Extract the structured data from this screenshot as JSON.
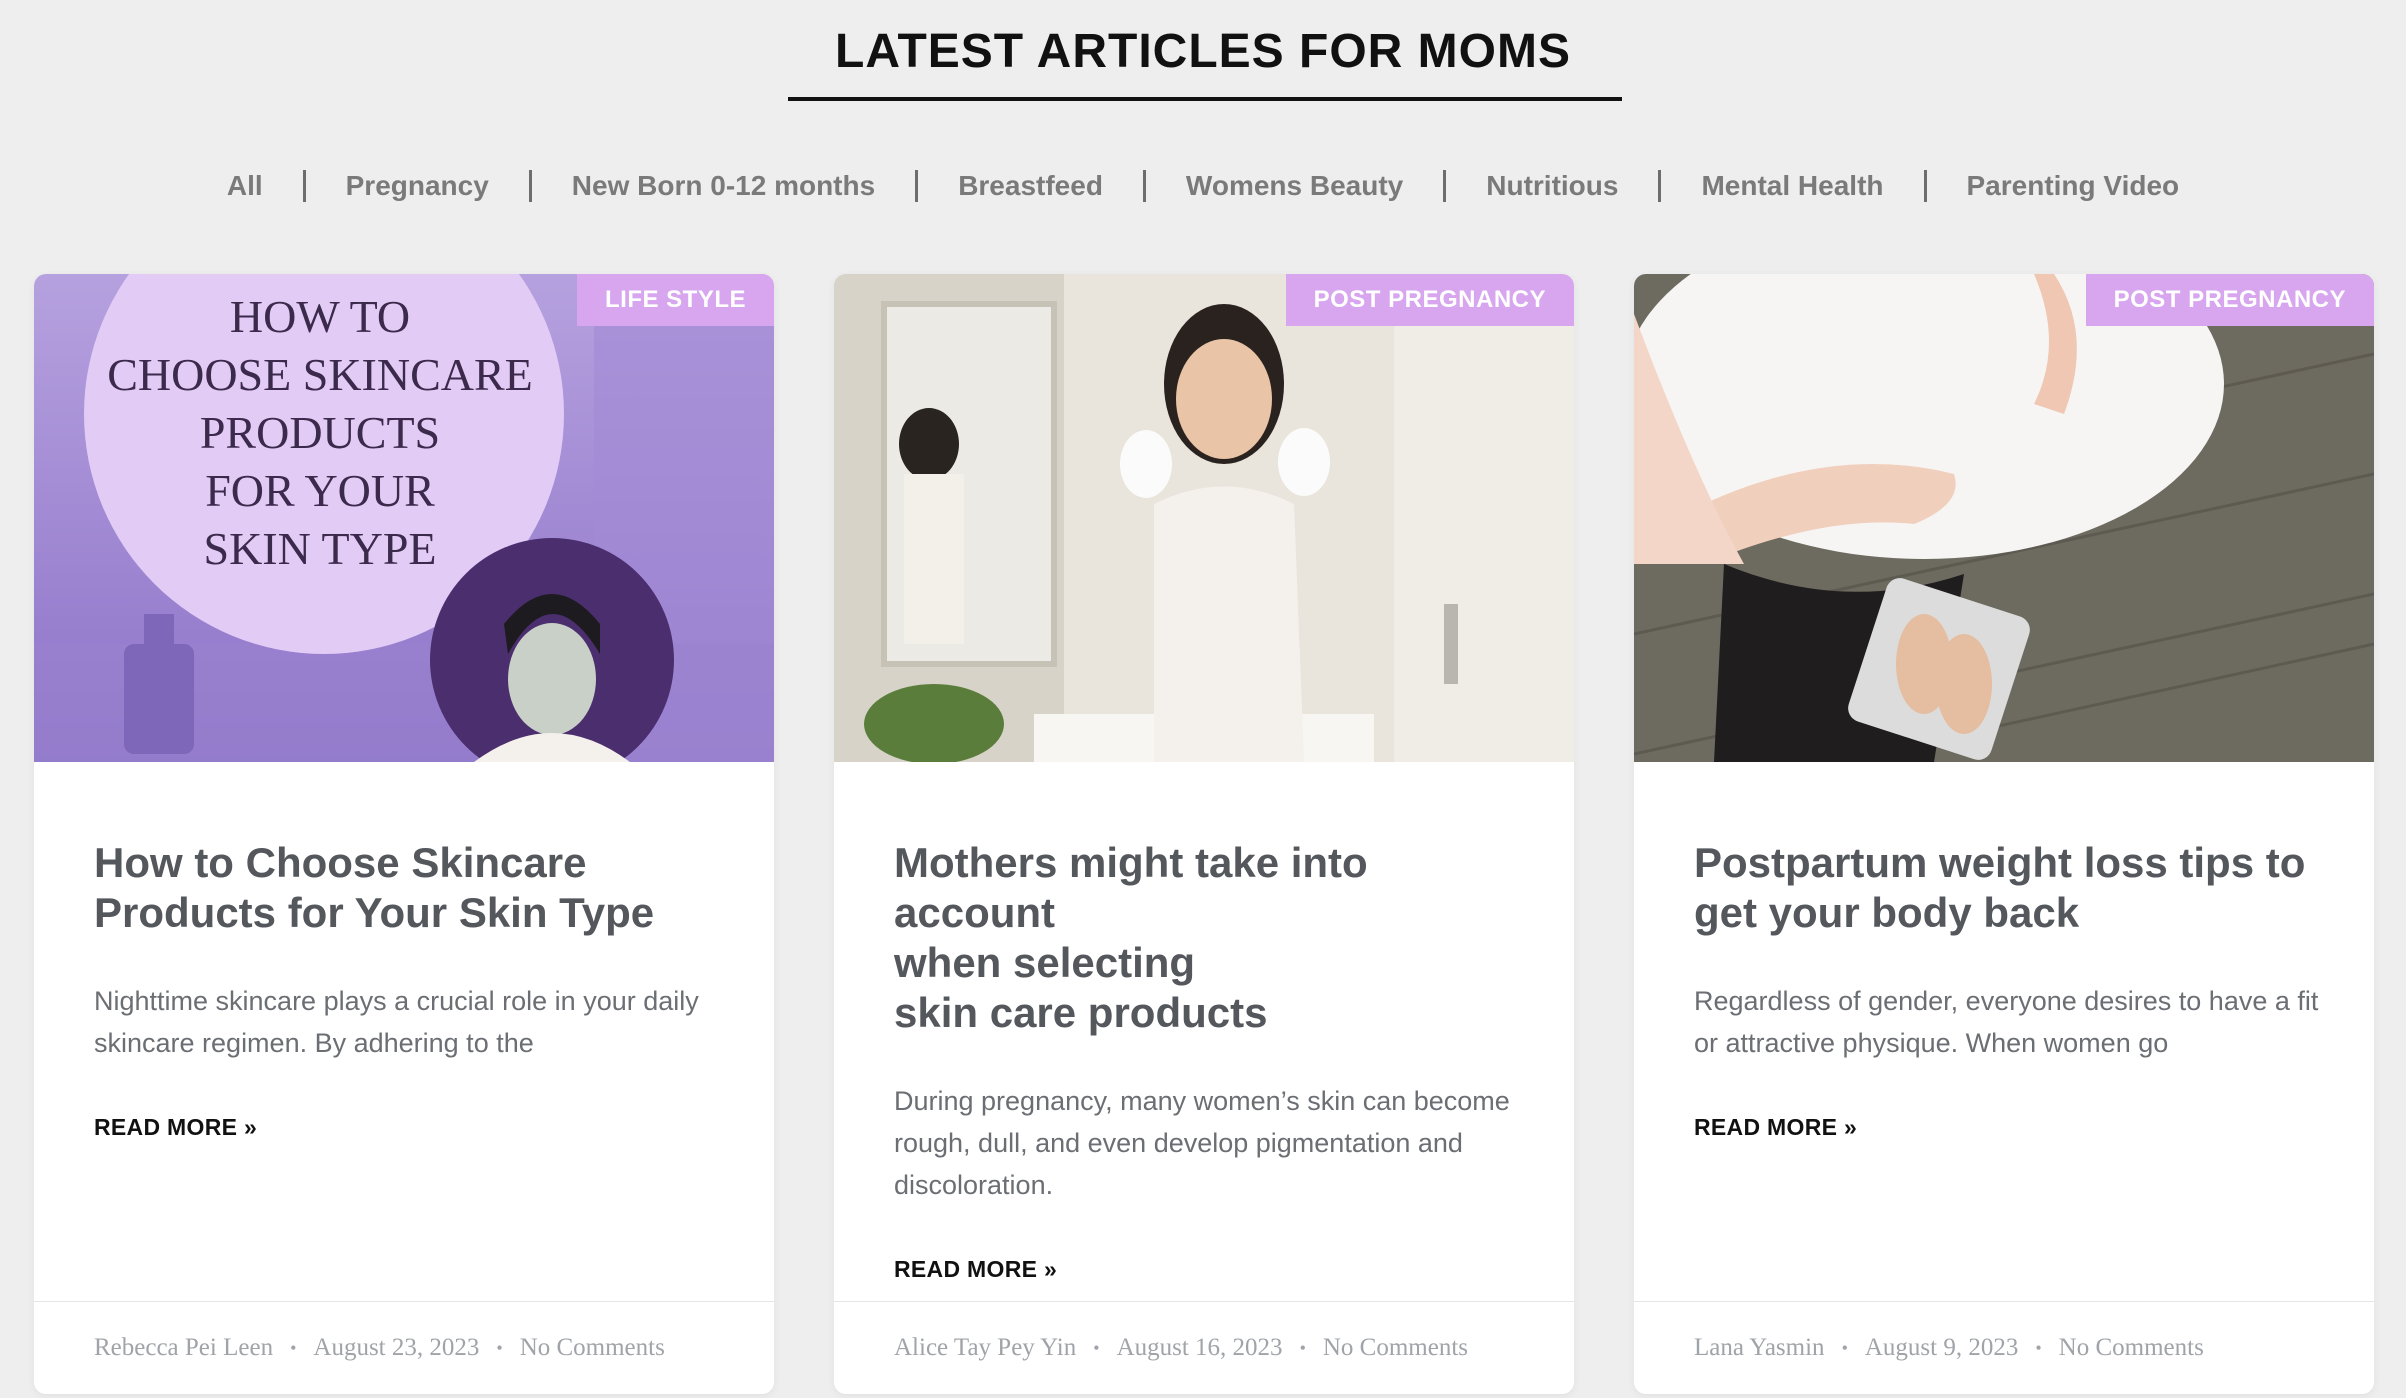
{
  "section": {
    "title": "LATEST ARTICLES FOR MOMS"
  },
  "filters": [
    "All",
    "Pregnancy",
    "New Born 0-12 months",
    "Breastfeed",
    "Womens Beauty",
    "Nutritious",
    "Mental Health",
    "Parenting Video"
  ],
  "cards": [
    {
      "badge": "LIFE STYLE",
      "thumb_text": [
        "HOW TO",
        "CHOOSE SKINCARE",
        "PRODUCTS",
        "FOR YOUR",
        "SKIN TYPE"
      ],
      "title_lines": [
        "How to Choose Skincare",
        "Products for Your Skin Type"
      ],
      "excerpt": "Nighttime skincare plays a crucial role in your daily skincare regimen. By adhering to the",
      "read_more": "READ MORE »",
      "author": "Rebecca Pei Leen",
      "date": "August 23, 2023",
      "comments": "No Comments"
    },
    {
      "badge": "POST PREGNANCY",
      "title_lines": [
        "Mothers might take into account",
        "when selecting",
        "skin care products"
      ],
      "excerpt": "During pregnancy, many women’s skin can become rough, dull, and even develop pigmentation and discoloration.",
      "read_more": "READ MORE »",
      "author": "Alice Tay Pey Yin",
      "date": "August 16, 2023",
      "comments": "No Comments"
    },
    {
      "badge": "POST PREGNANCY",
      "title_lines": [
        "Postpartum weight loss tips to",
        "get your body back"
      ],
      "excerpt": "Regardless of gender, everyone desires to have a fit or attractive physique. When women go",
      "read_more": "READ MORE »",
      "author": "Lana Yasmin",
      "date": "August 9, 2023",
      "comments": "No Comments"
    }
  ],
  "colors": {
    "badge": "#d7a6ef",
    "background": "#eeeeee",
    "title": "#54575c"
  }
}
